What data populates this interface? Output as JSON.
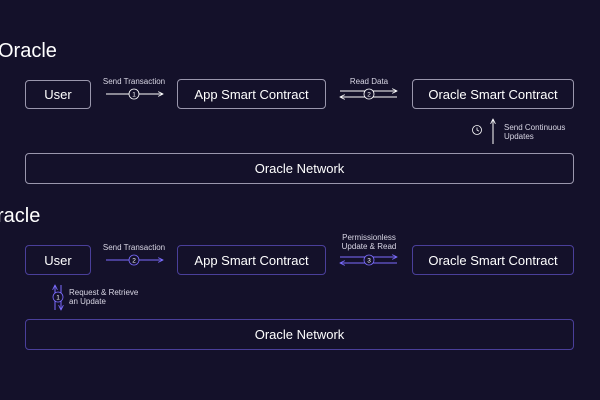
{
  "colors": {
    "background": "#14112a",
    "box_border_top": "#9a97ad",
    "box_border_bottom": "#4a3f9a",
    "arrow_top": "#ffffff",
    "arrow_bottom": "#7b6cff"
  },
  "top": {
    "title": "Oracle",
    "user": "User",
    "app_contract": "App Smart Contract",
    "oracle_contract": "Oracle Smart Contract",
    "network": "Oracle Network",
    "send_transaction": "Send Transaction",
    "step1": "1",
    "read_data": "Read Data",
    "step2": "2",
    "continuous_1": "Send Continuous",
    "continuous_2": "Updates"
  },
  "bottom": {
    "title": "racle",
    "user": "User",
    "app_contract": "App Smart Contract",
    "oracle_contract": "Oracle Smart Contract",
    "network": "Oracle Network",
    "send_transaction": "Send Transaction",
    "step2": "2",
    "permissionless_1": "Permissionless",
    "permissionless_2": "Update & Read",
    "step3": "3",
    "request_1": "Request & Retrieve",
    "request_2": "an Update",
    "step1": "1"
  }
}
